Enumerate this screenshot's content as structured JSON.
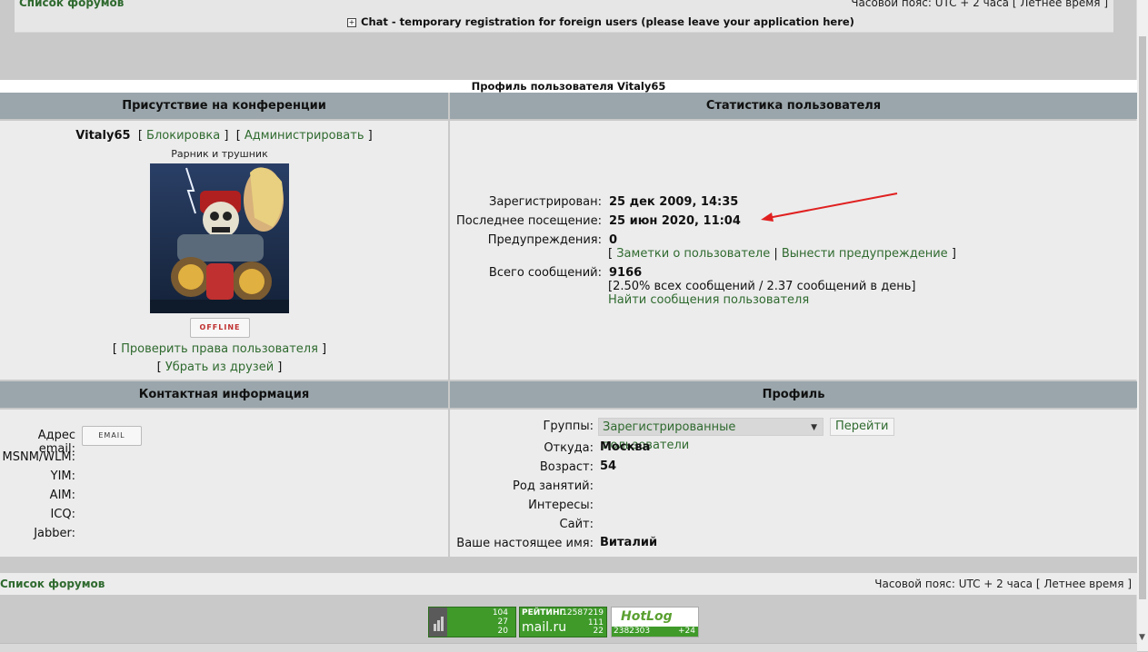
{
  "top": {
    "forum_list": "Список форумов",
    "timezone": "Часовой пояс: UTC + 2 часа [ Летнее время ]",
    "chat_link": "Chat - temporary registration for foreign users (please leave your application here)"
  },
  "profile": {
    "title": "Профиль пользователя Vitaly65",
    "presence_header": "Присутствие на конференции",
    "stats_header": "Статистика пользователя",
    "username": "Vitaly65",
    "block_link": "Блокировка",
    "admin_link": "Администрировать",
    "user_title": "Рарник и трушник",
    "offline_label": "OFFLINE",
    "check_rights_link": "Проверить права пользователя",
    "remove_friend_link": "Убрать из друзей"
  },
  "stats": {
    "registered_label": "Зарегистрирован:",
    "registered_value": "25 дек 2009, 14:35",
    "last_visit_label": "Последнее посещение:",
    "last_visit_value": "25 июн 2020, 11:04",
    "warnings_label": "Предупреждения:",
    "warnings_value": "0",
    "notes_link": "Заметки о пользователе",
    "warn_link": "Вынести предупреждение",
    "posts_label": "Всего сообщений:",
    "posts_value": "9166",
    "posts_detail": "[2.50% всех сообщений / 2.37 сообщений в день]",
    "find_posts_link": "Найти сообщения пользователя"
  },
  "contact": {
    "header": "Контактная информация",
    "email_label": "Адрес email:",
    "email_button": "EMAIL",
    "msnm_label": "MSNM/WLM:",
    "yim_label": "YIM:",
    "aim_label": "AIM:",
    "icq_label": "ICQ:",
    "jabber_label": "Jabber:"
  },
  "profile_info": {
    "header": "Профиль",
    "groups_label": "Группы:",
    "groups_value": "Зарегистрированные пользователи",
    "go_button": "Перейти",
    "from_label": "Откуда:",
    "from_value": "Москва",
    "age_label": "Возраст:",
    "age_value": "54",
    "occupation_label": "Род занятий:",
    "interests_label": "Интересы:",
    "site_label": "Сайт:",
    "realname_label": "Ваше настоящее имя:",
    "realname_value": "Виталий"
  },
  "footer": {
    "forum_list": "Список форумов",
    "timezone": "Часовой пояс: UTC + 2 часа [ Летнее время ]"
  },
  "counters": {
    "c1_a": "104",
    "c1_b": "27",
    "c1_c": "20",
    "c2_title": "РЕЙТИНГ",
    "c2_num": "12587219",
    "c2_logo": "mail.ru",
    "c2_b": "111",
    "c2_c": "22",
    "c3_logo": "HotLog",
    "c3_num": "2382303",
    "c3_delta": "+24"
  },
  "colors": {
    "header_bg": "#9aa6ab",
    "cell_bg": "#ececec",
    "link": "#2f6a2f",
    "annotation_arrow": "#e02020"
  }
}
